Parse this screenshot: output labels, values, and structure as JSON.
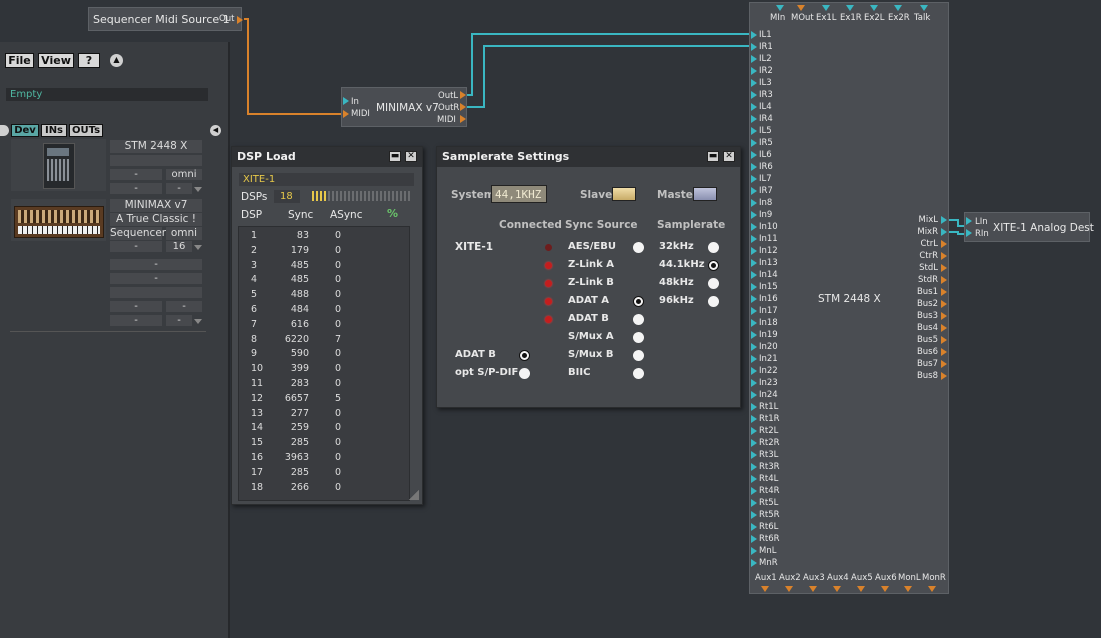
{
  "colors": {
    "background": "#303439",
    "module": "#4a4d52",
    "midi_wire": "#d9822b",
    "audio_wire": "#3ab7c2"
  },
  "midi_source": {
    "label": "Sequencer Midi Source 1",
    "out": "Out"
  },
  "minimax": {
    "name": "MINIMAX v7",
    "in": "In",
    "midi_in": "MIDI",
    "outL": "OutL",
    "outR": "OutR",
    "midi_out": "MIDI"
  },
  "analog_dest": {
    "name": "XITE-1 Analog Dest",
    "lin": "LIn",
    "rin": "RIn"
  },
  "left_panel": {
    "menu": [
      "File",
      "View",
      "?"
    ],
    "collapse_icon": "up-arrow-icon",
    "empty_field": "Empty",
    "tabs": [
      "Dev",
      "INs",
      "OUTs"
    ],
    "device1": {
      "name": "STM 2448 X",
      "c1": "-",
      "c2": "omni",
      "c3": "-",
      "c4": "-"
    },
    "device2": {
      "name": "MINIMAX v7",
      "sub": "A True Classic !",
      "src": "Sequencer",
      "ch": "omni",
      "c3": "-",
      "c4": "16"
    },
    "rows": [
      "-",
      "-",
      "-",
      "-",
      "-",
      "-"
    ]
  },
  "dsp_load": {
    "title": "DSP Load",
    "device": "XITE-1",
    "dsps_label": "DSPs",
    "dsps_value": "18",
    "headers": [
      "DSP",
      "Sync",
      "ASync"
    ],
    "percent_icon": "%",
    "rows": [
      [
        "1",
        "83",
        "0"
      ],
      [
        "2",
        "179",
        "0"
      ],
      [
        "3",
        "485",
        "0"
      ],
      [
        "4",
        "485",
        "0"
      ],
      [
        "5",
        "488",
        "0"
      ],
      [
        "6",
        "484",
        "0"
      ],
      [
        "7",
        "616",
        "0"
      ],
      [
        "8",
        "6220",
        "7"
      ],
      [
        "9",
        "590",
        "0"
      ],
      [
        "10",
        "399",
        "0"
      ],
      [
        "11",
        "283",
        "0"
      ],
      [
        "12",
        "6657",
        "5"
      ],
      [
        "13",
        "277",
        "0"
      ],
      [
        "14",
        "259",
        "0"
      ],
      [
        "15",
        "285",
        "0"
      ],
      [
        "16",
        "3963",
        "0"
      ],
      [
        "17",
        "285",
        "0"
      ],
      [
        "18",
        "266",
        "0"
      ]
    ]
  },
  "samplerate": {
    "title": "Samplerate Settings",
    "system_label": "System",
    "system_value": "44,1KHZ",
    "slave_label": "Slave",
    "master_label": "Master",
    "col_connected": "Connected",
    "col_sync": "Sync Source",
    "col_rate": "Samplerate",
    "device": "XITE-1",
    "sync_sources": [
      "AES/EBU",
      "Z-Link A",
      "Z-Link B",
      "ADAT A",
      "ADAT B",
      "S/Mux A",
      "S/Mux B",
      "BIIC"
    ],
    "rates": [
      "32kHz",
      "44.1kHz",
      "48kHz",
      "96kHz"
    ],
    "adat_b": "ADAT B",
    "opt_spdif": "opt S/P-DIF"
  },
  "stm": {
    "name": "STM 2448 X",
    "top_ports": [
      "MIn",
      "MOut",
      "Ex1L",
      "Ex1R",
      "Ex2L",
      "Ex2R",
      "Talk"
    ],
    "left_ports": [
      "IL1",
      "IR1",
      "IL2",
      "IR2",
      "IL3",
      "IR3",
      "IL4",
      "IR4",
      "IL5",
      "IR5",
      "IL6",
      "IR6",
      "IL7",
      "IR7",
      "In8",
      "In9",
      "In10",
      "In11",
      "In12",
      "In13",
      "In14",
      "In15",
      "In16",
      "In17",
      "In18",
      "In19",
      "In20",
      "In21",
      "In22",
      "In23",
      "In24",
      "Rt1L",
      "Rt1R",
      "Rt2L",
      "Rt2R",
      "Rt3L",
      "Rt3R",
      "Rt4L",
      "Rt4R",
      "Rt5L",
      "Rt5R",
      "Rt6L",
      "Rt6R",
      "MnL",
      "MnR"
    ],
    "right_ports": [
      "MixL",
      "MixR",
      "CtrL",
      "CtrR",
      "StdL",
      "StdR",
      "Bus1",
      "Bus2",
      "Bus3",
      "Bus4",
      "Bus5",
      "Bus6",
      "Bus7",
      "Bus8"
    ],
    "bottom_ports": [
      "Aux1",
      "Aux2",
      "Aux3",
      "Aux4",
      "Aux5",
      "Aux6",
      "MonL",
      "MonR"
    ]
  }
}
